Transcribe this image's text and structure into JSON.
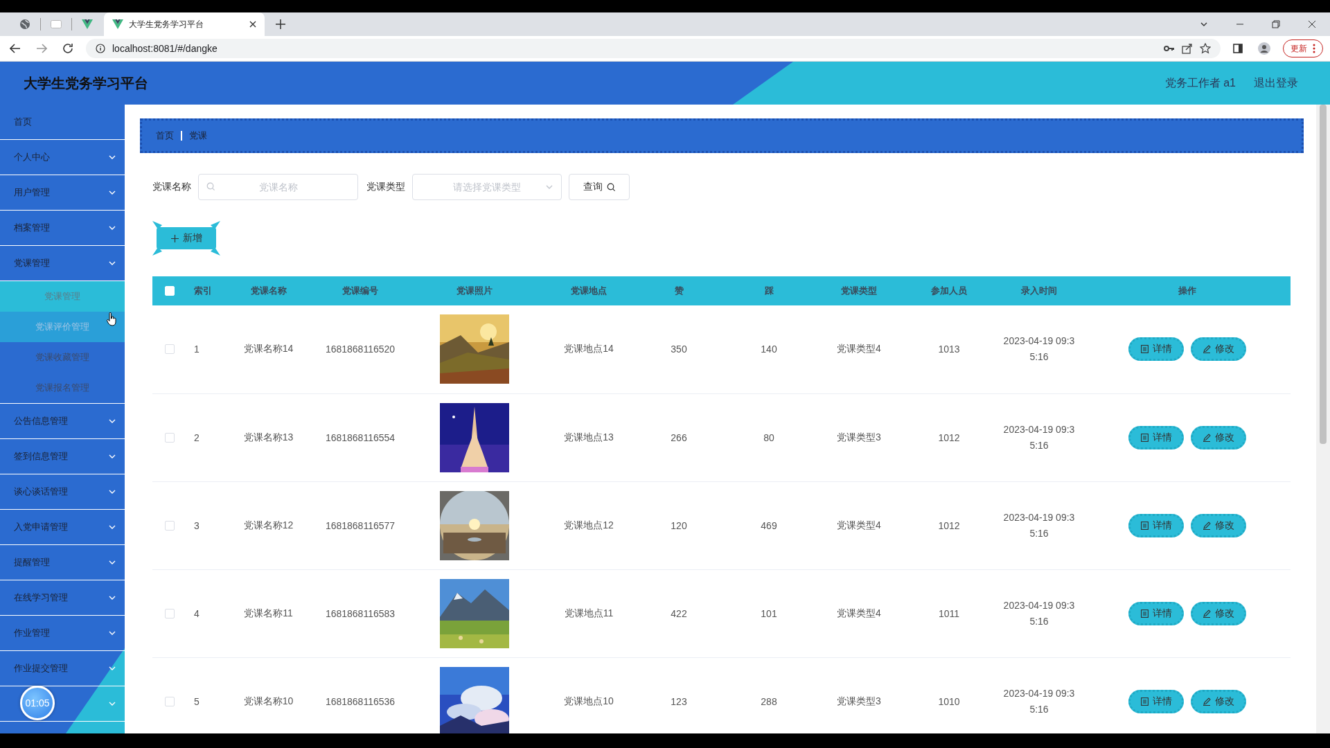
{
  "browser": {
    "tab_title": "大学生党务学习平台",
    "address": "localhost:8081/#/dangke",
    "update_button": "更新"
  },
  "app": {
    "title": "大学生党务学习平台",
    "user": "党务工作者 a1",
    "logout": "退出登录"
  },
  "sidebar": {
    "items": [
      {
        "label": "首页",
        "expandable": false
      },
      {
        "label": "个人中心",
        "expandable": true
      },
      {
        "label": "用户管理",
        "expandable": true
      },
      {
        "label": "档案管理",
        "expandable": true
      },
      {
        "label": "党课管理",
        "expandable": true,
        "expanded": true,
        "children": [
          {
            "label": "党课管理",
            "selected": true,
            "hovered": false
          },
          {
            "label": "党课评价管理",
            "selected": false,
            "hovered": true
          },
          {
            "label": "党课收藏管理",
            "selected": false,
            "hovered": false
          },
          {
            "label": "党课报名管理",
            "selected": false,
            "hovered": false
          }
        ]
      },
      {
        "label": "公告信息管理",
        "expandable": true
      },
      {
        "label": "签到信息管理",
        "expandable": true
      },
      {
        "label": "谈心谈话管理",
        "expandable": true
      },
      {
        "label": "入党申请管理",
        "expandable": true
      },
      {
        "label": "提醒管理",
        "expandable": true
      },
      {
        "label": "在线学习管理",
        "expandable": true
      },
      {
        "label": "作业管理",
        "expandable": true
      },
      {
        "label": "作业提交管理",
        "expandable": true
      },
      {
        "expandable": true
      }
    ]
  },
  "timer": "01:05",
  "breadcrumb": [
    "首页",
    "党课"
  ],
  "search": {
    "fields": [
      {
        "label": "党课名称",
        "kind": "text",
        "placeholder": "党课名称"
      },
      {
        "label": "党课类型",
        "kind": "select",
        "placeholder": "请选择党课类型"
      }
    ],
    "button": "查询"
  },
  "add_button": "新增",
  "table": {
    "all_checked": false,
    "columns": [
      "索引",
      "党课名称",
      "党课编号",
      "党课照片",
      "党课地点",
      "赞",
      "踩",
      "党课类型",
      "参加人员",
      "录入时间",
      "操作"
    ],
    "rows": [
      {
        "checked": false,
        "index": "1",
        "name": "党课名称14",
        "code": "1681868116520",
        "location": "党课地点14",
        "likes": "350",
        "dislikes": "140",
        "type": "党课类型4",
        "participants": "1013",
        "time": "2023-04-19 09:35:16",
        "actions": [
          "详情",
          "修改"
        ]
      },
      {
        "checked": false,
        "index": "2",
        "name": "党课名称13",
        "code": "1681868116554",
        "location": "党课地点13",
        "likes": "266",
        "dislikes": "80",
        "type": "党课类型3",
        "participants": "1012",
        "time": "2023-04-19 09:35:16",
        "actions": [
          "详情",
          "修改"
        ]
      },
      {
        "checked": false,
        "index": "3",
        "name": "党课名称12",
        "code": "1681868116577",
        "location": "党课地点12",
        "likes": "120",
        "dislikes": "469",
        "type": "党课类型4",
        "participants": "1012",
        "time": "2023-04-19 09:35:16",
        "actions": [
          "详情",
          "修改"
        ]
      },
      {
        "checked": false,
        "index": "4",
        "name": "党课名称11",
        "code": "1681868116583",
        "location": "党课地点11",
        "likes": "422",
        "dislikes": "101",
        "type": "党课类型4",
        "participants": "1011",
        "time": "2023-04-19 09:35:16",
        "actions": [
          "详情",
          "修改"
        ]
      },
      {
        "checked": false,
        "index": "5",
        "name": "党课名称10",
        "code": "1681868116536",
        "location": "党课地点10",
        "likes": "123",
        "dislikes": "288",
        "type": "党课类型3",
        "participants": "1010",
        "time": "2023-04-19 09:35:16",
        "actions": [
          "详情",
          "修改"
        ]
      }
    ]
  }
}
